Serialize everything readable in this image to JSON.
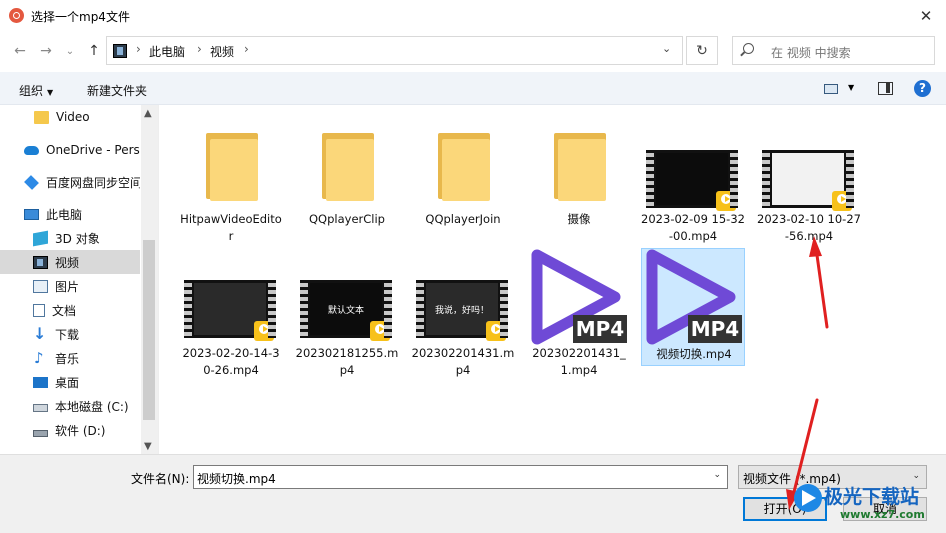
{
  "window": {
    "title": "选择一个mp4文件",
    "close_glyph": "✕"
  },
  "nav": {
    "back": "←",
    "forward": "→",
    "recent": "⌄",
    "up": "↑",
    "breadcrumbs": [
      "此电脑",
      "视频"
    ],
    "separator": "›",
    "refresh": "↻",
    "search_placeholder": "在 视频 中搜索"
  },
  "toolbar": {
    "organize": "组织",
    "organize_caret": "▼",
    "new_folder": "新建文件夹",
    "view_caret": "▼",
    "help": "?"
  },
  "sidebar": {
    "items": [
      {
        "label": "Video",
        "icon": "folder-icon"
      },
      {
        "label": "OneDrive - Personal",
        "icon": "cloud-icon"
      },
      {
        "label": "百度网盘同步空间",
        "icon": "baidu-icon"
      },
      {
        "label": "此电脑",
        "icon": "pc-icon"
      },
      {
        "label": "3D 对象",
        "icon": "3d-icon"
      },
      {
        "label": "视频",
        "icon": "video-icon",
        "selected": true
      },
      {
        "label": "图片",
        "icon": "pictures-icon"
      },
      {
        "label": "文档",
        "icon": "documents-icon"
      },
      {
        "label": "下载",
        "icon": "download-icon"
      },
      {
        "label": "音乐",
        "icon": "music-icon"
      },
      {
        "label": "桌面",
        "icon": "desktop-icon"
      },
      {
        "label": "本地磁盘 (C:)",
        "icon": "drive-icon"
      },
      {
        "label": "软件 (D:)",
        "icon": "disk-icon"
      }
    ],
    "scroll_up": "▲",
    "scroll_down": "▼"
  },
  "files": [
    {
      "name": "HitpawVideoEditor",
      "type": "folder"
    },
    {
      "name": "QQplayerClip",
      "type": "folder"
    },
    {
      "name": "QQplayerJoin",
      "type": "folder"
    },
    {
      "name": "摄像",
      "type": "folder"
    },
    {
      "name": "2023-02-09 15-32-00.mp4",
      "type": "video"
    },
    {
      "name": "2023-02-10 10-27-56.mp4",
      "type": "video"
    },
    {
      "name": "2023-02-20-14-30-26.mp4",
      "type": "video"
    },
    {
      "name": "202302181255.mp4",
      "type": "video",
      "thumb_text": "默认文本"
    },
    {
      "name": "202302201431.mp4",
      "type": "video",
      "thumb_text": "我说，好吗！"
    },
    {
      "name": "202302201431_1.mp4",
      "type": "mp4"
    },
    {
      "name": "视频切换.mp4",
      "type": "mp4",
      "selected": true
    }
  ],
  "mp4_label": "MP4",
  "bottom": {
    "filename_label": "文件名(N):",
    "filename_value": "视频切换.mp4",
    "filetype": "视频文件 (*.mp4)",
    "dd": "⌄",
    "open": "打开(O)",
    "cancel": "取消"
  },
  "watermark": {
    "text": "极光下载站",
    "url": "www.xz7.com"
  },
  "colors": {
    "selection": "#cce8ff",
    "accent": "#0078d7",
    "mp4_purple": "#6f4ad6",
    "arrow": "#e02020"
  }
}
